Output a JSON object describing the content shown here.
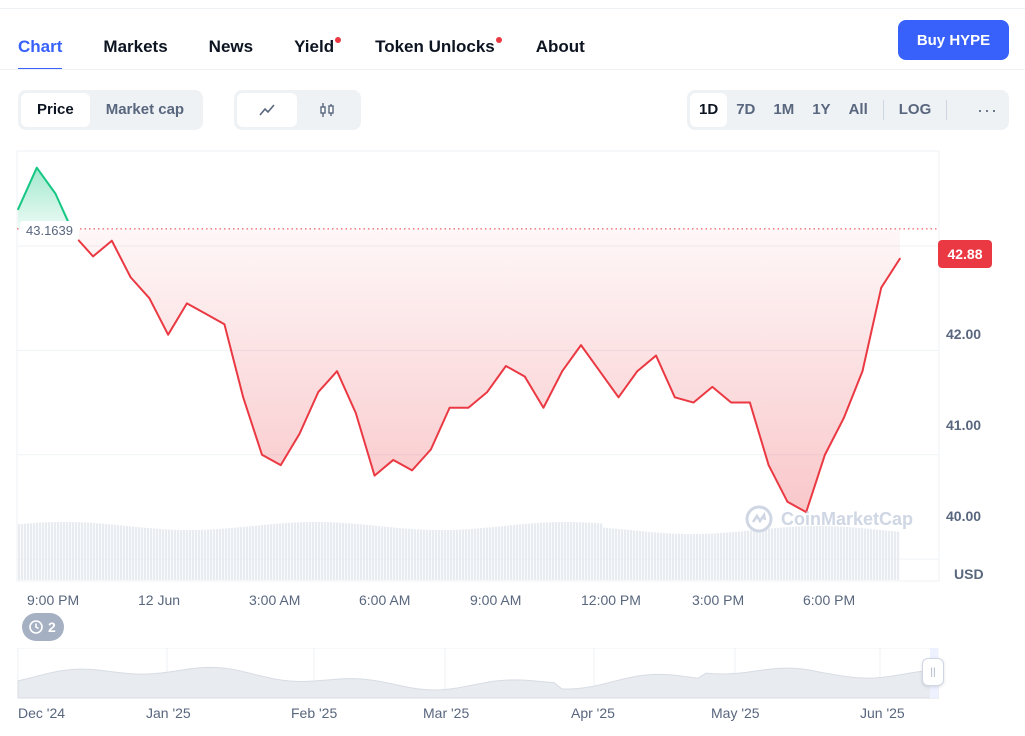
{
  "tabs": [
    {
      "label": "Chart",
      "active": true,
      "dot": false
    },
    {
      "label": "Markets",
      "active": false,
      "dot": false
    },
    {
      "label": "News",
      "active": false,
      "dot": false
    },
    {
      "label": "Yield",
      "active": false,
      "dot": true
    },
    {
      "label": "Token Unlocks",
      "active": false,
      "dot": true
    },
    {
      "label": "About",
      "active": false,
      "dot": false
    }
  ],
  "buy_button_label": "Buy HYPE",
  "metric_toggle": {
    "options": [
      "Price",
      "Market cap"
    ],
    "selected": "Price"
  },
  "chart_type_toggle": {
    "options": [
      "line-chart-icon",
      "candlestick-icon"
    ],
    "selected": "line-chart-icon"
  },
  "range_options": [
    "1D",
    "7D",
    "1M",
    "1Y",
    "All"
  ],
  "range_selected": "1D",
  "scale_option": "LOG",
  "more_label": "···",
  "chart": {
    "open_price_label": "43.1639",
    "current_price_label": "42.88",
    "currency_label": "USD",
    "watermark": "CoinMarketCap",
    "y_ticks": [
      "42.00",
      "41.00",
      "40.00"
    ],
    "x_ticks": [
      "9:00 PM",
      "12 Jun",
      "3:00 AM",
      "6:00 AM",
      "9:00 AM",
      "12:00 PM",
      "3:00 PM",
      "6:00 PM"
    ],
    "colors": {
      "up": "#16c784",
      "down": "#ea3943",
      "grid": "#eff2f5"
    },
    "history_badge": "2"
  },
  "navigator": {
    "labels": [
      "Dec '24",
      "Jan '25",
      "Feb '25",
      "Mar '25",
      "Apr '25",
      "May '25",
      "Jun '25"
    ]
  },
  "chart_data": {
    "type": "line",
    "title": "",
    "xlabel": "",
    "ylabel": "USD",
    "ylim": [
      39.8,
      43.9
    ],
    "baseline": 43.1639,
    "x": [
      "20:00",
      "20:30",
      "21:00",
      "21:30",
      "22:00",
      "22:30",
      "23:00",
      "23:30",
      "00:00",
      "00:30",
      "01:00",
      "01:30",
      "02:00",
      "02:30",
      "03:00",
      "03:30",
      "04:00",
      "04:30",
      "05:00",
      "05:30",
      "06:00",
      "06:30",
      "07:00",
      "07:30",
      "08:00",
      "08:30",
      "09:00",
      "09:30",
      "10:00",
      "10:30",
      "11:00",
      "11:30",
      "12:00",
      "12:30",
      "13:00",
      "13:30",
      "14:00",
      "14:30",
      "15:00",
      "15:30",
      "16:00",
      "16:30",
      "17:00",
      "17:30",
      "18:00",
      "18:30",
      "19:00",
      "19:30"
    ],
    "values": [
      43.35,
      43.75,
      43.5,
      43.1,
      42.9,
      43.05,
      42.7,
      42.5,
      42.15,
      42.45,
      42.35,
      42.25,
      41.55,
      41.0,
      40.9,
      41.2,
      41.6,
      41.8,
      41.4,
      40.8,
      40.95,
      40.85,
      41.05,
      41.45,
      41.45,
      41.6,
      41.85,
      41.75,
      41.45,
      41.8,
      42.05,
      41.8,
      41.55,
      41.8,
      41.95,
      41.55,
      41.5,
      41.65,
      41.5,
      41.5,
      40.9,
      40.55,
      40.45,
      41.0,
      41.35,
      41.8,
      42.6,
      42.88
    ],
    "series": [
      {
        "values": "see values"
      }
    ],
    "grid": true
  }
}
